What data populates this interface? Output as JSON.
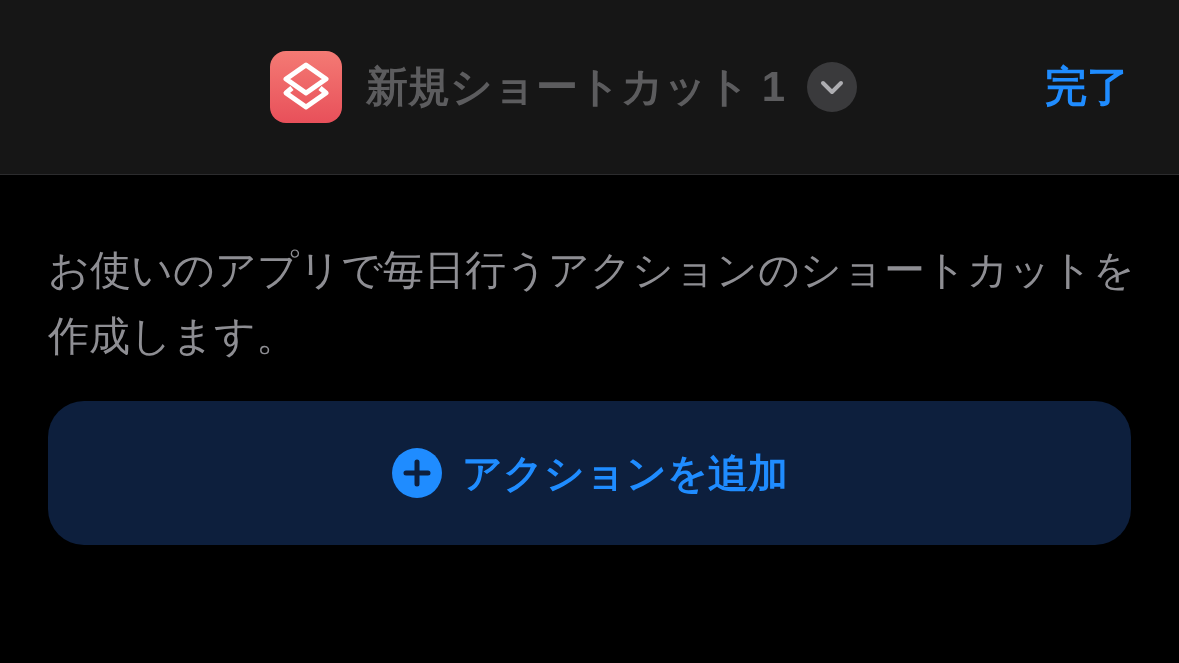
{
  "header": {
    "title": "新規ショートカット 1",
    "done_button": "完了"
  },
  "description": "お使いのアプリで毎日行うアクションのショートカットを作成します。",
  "add_action_button": {
    "label": "アクションを追加"
  }
}
